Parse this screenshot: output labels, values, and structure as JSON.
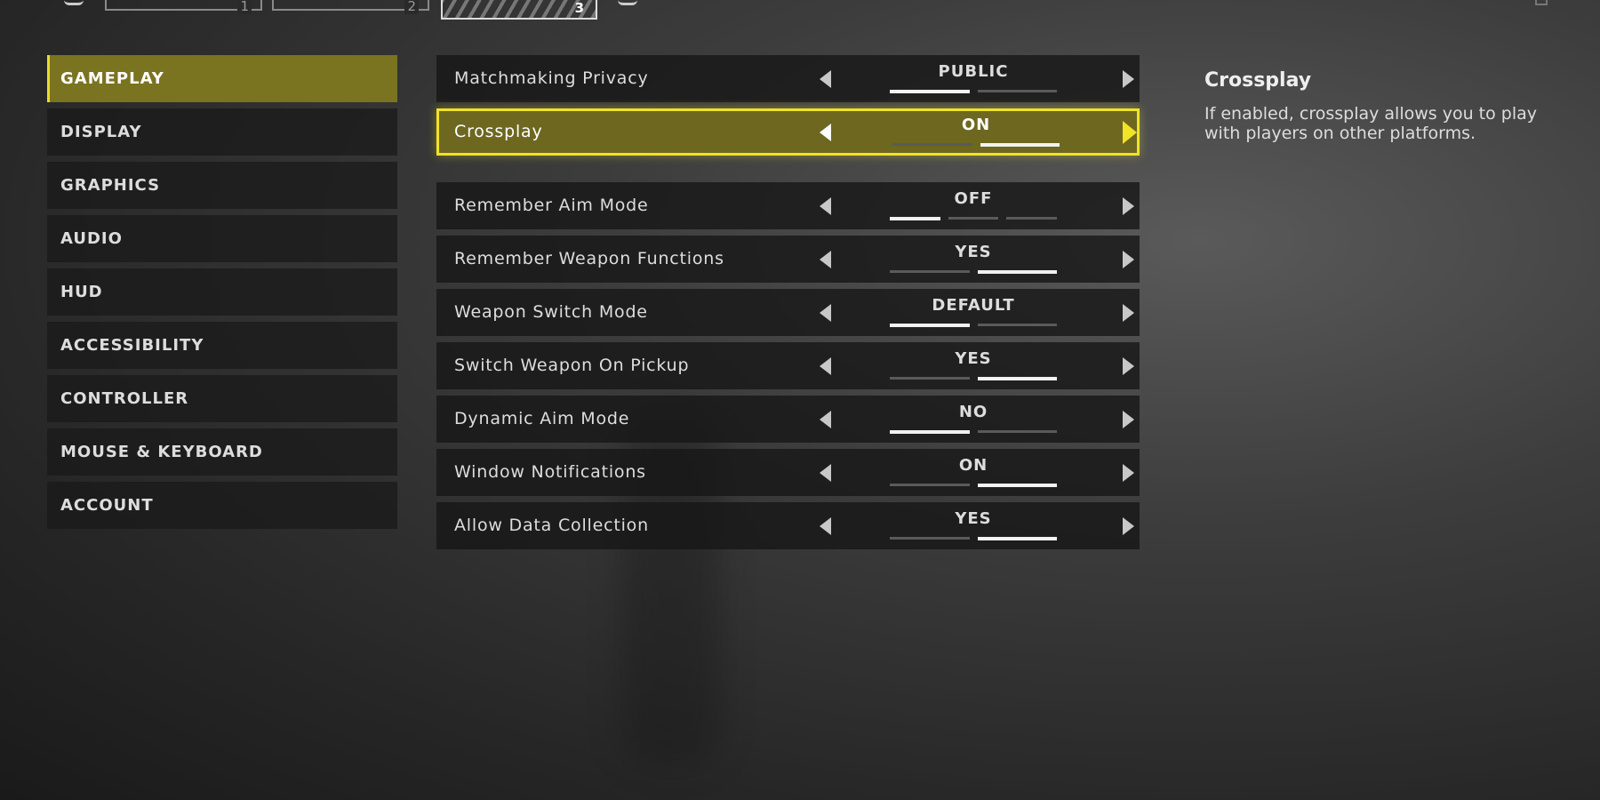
{
  "top_tabs": [
    {
      "number": "1"
    },
    {
      "number": "2"
    },
    {
      "number": "3",
      "active": true
    }
  ],
  "sidebar": {
    "items": [
      {
        "label": "GAMEPLAY",
        "active": true
      },
      {
        "label": "DISPLAY"
      },
      {
        "label": "GRAPHICS"
      },
      {
        "label": "AUDIO"
      },
      {
        "label": "HUD"
      },
      {
        "label": "ACCESSIBILITY"
      },
      {
        "label": "CONTROLLER"
      },
      {
        "label": "MOUSE & KEYBOARD"
      },
      {
        "label": "ACCOUNT"
      }
    ]
  },
  "settings": [
    {
      "label": "Matchmaking Privacy",
      "value": "PUBLIC",
      "options": 2,
      "selected_index": 0
    },
    {
      "label": "Crossplay",
      "value": "ON",
      "options": 2,
      "selected_index": 1,
      "focused": true
    },
    {
      "label": "Remember Aim Mode",
      "value": "OFF",
      "options": 3,
      "selected_index": 0
    },
    {
      "label": "Remember Weapon Functions",
      "value": "YES",
      "options": 2,
      "selected_index": 1
    },
    {
      "label": "Weapon Switch Mode",
      "value": "DEFAULT",
      "options": 2,
      "selected_index": 0
    },
    {
      "label": "Switch Weapon On Pickup",
      "value": "YES",
      "options": 2,
      "selected_index": 1
    },
    {
      "label": "Dynamic Aim Mode",
      "value": "NO",
      "options": 2,
      "selected_index": 0
    },
    {
      "label": "Window Notifications",
      "value": "ON",
      "options": 2,
      "selected_index": 1
    },
    {
      "label": "Allow Data Collection",
      "value": "YES",
      "options": 2,
      "selected_index": 1
    }
  ],
  "description": {
    "title": "Crossplay",
    "text": "If enabled, crossplay allows you to play with players on other platforms."
  },
  "colors": {
    "accent": "#f0e328",
    "active_bg": "#7a7320"
  }
}
